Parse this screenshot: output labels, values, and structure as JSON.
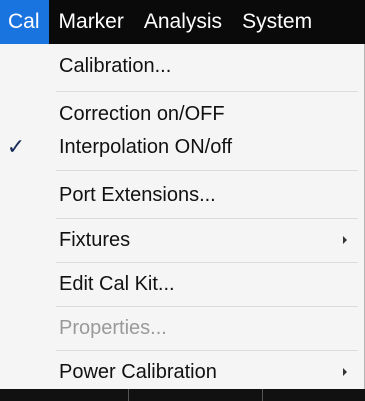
{
  "menubar": {
    "items": [
      {
        "label": "Cal"
      },
      {
        "label": "Marker"
      },
      {
        "label": "Analysis"
      },
      {
        "label": "System"
      }
    ]
  },
  "dropdown": {
    "items": [
      {
        "label": "Calibration...",
        "checked": false,
        "submenu": false,
        "enabled": true
      },
      {
        "label": "Correction on/OFF",
        "checked": false,
        "submenu": false,
        "enabled": true
      },
      {
        "label": "Interpolation ON/off",
        "checked": true,
        "submenu": false,
        "enabled": true
      },
      {
        "label": "Port Extensions...",
        "checked": false,
        "submenu": false,
        "enabled": true
      },
      {
        "label": "Fixtures",
        "checked": false,
        "submenu": true,
        "enabled": true
      },
      {
        "label": "Edit Cal Kit...",
        "checked": false,
        "submenu": false,
        "enabled": true
      },
      {
        "label": "Properties...",
        "checked": false,
        "submenu": false,
        "enabled": false
      },
      {
        "label": "Power Calibration",
        "checked": false,
        "submenu": true,
        "enabled": true
      }
    ],
    "check_glyph": "✓"
  },
  "colors": {
    "menubar_bg": "#0a0a0a",
    "active_bg": "#1a74e0",
    "dropdown_bg": "#f5f5f5",
    "disabled_text": "#9a9a9a"
  }
}
